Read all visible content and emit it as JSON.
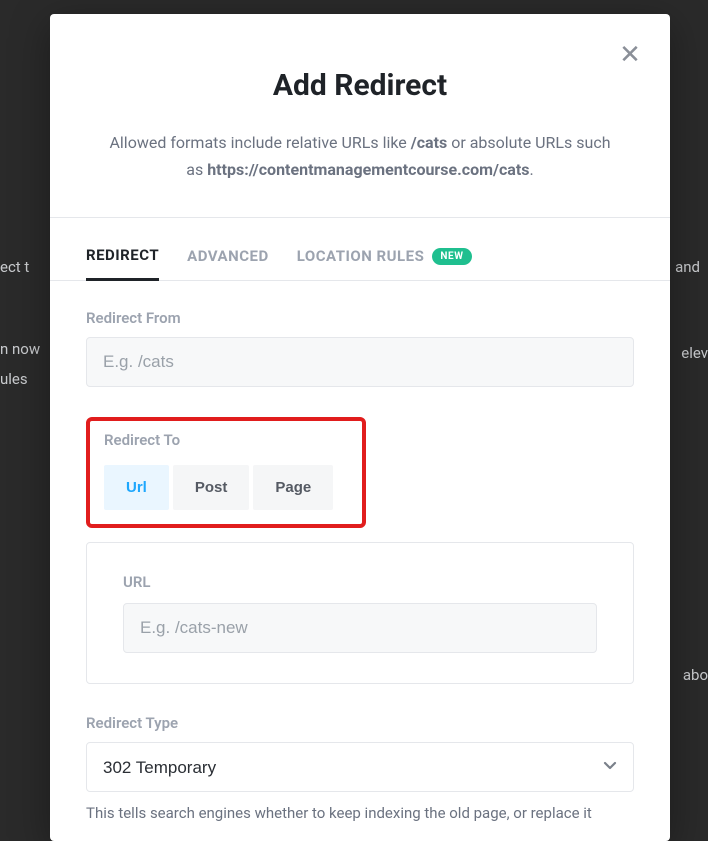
{
  "modal": {
    "title": "Add Redirect",
    "subtitle_pre": "Allowed formats include relative URLs like ",
    "subtitle_bold": "/cats",
    "subtitle_mid": " or absolute URLs such as ",
    "subtitle_bold2": "https://contentmanagementcourse.com/cats",
    "subtitle_post": "."
  },
  "tabs": {
    "redirect": "REDIRECT",
    "advanced": "ADVANCED",
    "location": "LOCATION RULES",
    "new_badge": "NEW"
  },
  "form": {
    "redirect_from_label": "Redirect From",
    "redirect_from_placeholder": "E.g. /cats",
    "redirect_to_label": "Redirect To",
    "seg_url": "Url",
    "seg_post": "Post",
    "seg_page": "Page",
    "url_label": "URL",
    "url_placeholder": "E.g. /cats-new",
    "redirect_type_label": "Redirect Type",
    "redirect_type_value": "302 Temporary",
    "redirect_type_help": "This tells search engines whether to keep indexing the old page, or replace it"
  },
  "bg": {
    "a": "ect t",
    "b": "and",
    "c": "n now",
    "d": "ules",
    "e": "elev",
    "f": "abo"
  }
}
